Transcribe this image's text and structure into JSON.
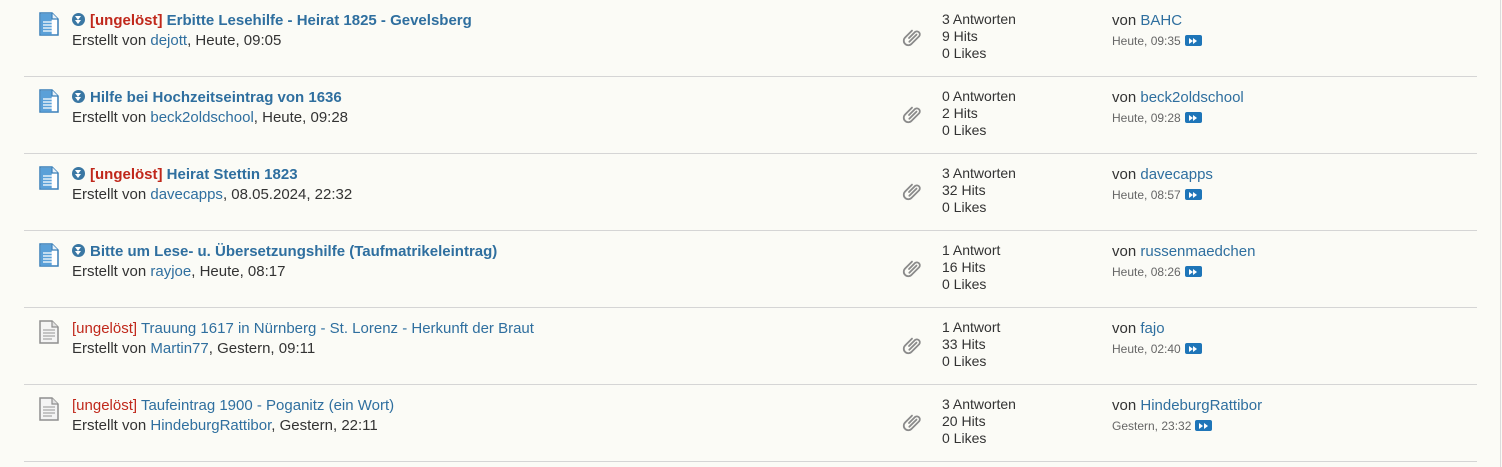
{
  "labels": {
    "created_by": "Erstellt von",
    "by": "von"
  },
  "colors": {
    "link": "#2f6f9f",
    "prefix_red": "#c0281b",
    "badge_blue": "#3a77a3",
    "jump_blue": "#1e75b8",
    "background": "#fbfbf6"
  },
  "threads": [
    {
      "unread": true,
      "icon": "unread-thread-icon",
      "prefix": "[ungelöst]",
      "title": "Erbitte Lesehilfe - Heirat 1825 - Gevelsberg",
      "author": "dejott",
      "created": ", Heute, 09:05",
      "replies": "3 Antworten",
      "hits": "9 Hits",
      "likes": "0 Likes",
      "last_user": "BAHC",
      "last_time": "Heute, 09:35"
    },
    {
      "unread": true,
      "icon": "unread-thread-icon",
      "prefix": "",
      "title": "Hilfe bei Hochzeitseintrag von 1636",
      "author": "beck2oldschool",
      "created": ", Heute, 09:28",
      "replies": "0 Antworten",
      "hits": "2 Hits",
      "likes": "0 Likes",
      "last_user": "beck2oldschool",
      "last_time": "Heute, 09:28"
    },
    {
      "unread": true,
      "icon": "unread-thread-icon",
      "prefix": "[ungelöst]",
      "title": "Heirat Stettin 1823",
      "author": "davecapps",
      "created": ", 08.05.2024, 22:32",
      "replies": "3 Antworten",
      "hits": "32 Hits",
      "likes": "0 Likes",
      "last_user": "davecapps",
      "last_time": "Heute, 08:57"
    },
    {
      "unread": true,
      "icon": "unread-thread-icon",
      "prefix": "",
      "title": "Bitte um Lese- u. Übersetzungshilfe (Taufmatrikeleintrag)",
      "author": "rayjoe",
      "created": ", Heute, 08:17",
      "replies": "1 Antwort",
      "hits": "16 Hits",
      "likes": "0 Likes",
      "last_user": "russenmaedchen",
      "last_time": "Heute, 08:26"
    },
    {
      "unread": false,
      "icon": "read-thread-icon",
      "prefix": "[ungelöst]",
      "title": "Trauung 1617 in Nürnberg - St. Lorenz - Herkunft der Braut",
      "author": "Martin77",
      "created": ", Gestern, 09:11",
      "replies": "1 Antwort",
      "hits": "33 Hits",
      "likes": "0 Likes",
      "last_user": "fajo",
      "last_time": "Heute, 02:40"
    },
    {
      "unread": false,
      "icon": "read-thread-icon",
      "prefix": "[ungelöst]",
      "title": "Taufeintrag 1900 - Poganitz (ein Wort)",
      "author": "HindeburgRattibor",
      "created": ", Gestern, 22:11",
      "replies": "3 Antworten",
      "hits": "20 Hits",
      "likes": "0 Likes",
      "last_user": "HindeburgRattibor",
      "last_time": "Gestern, 23:32"
    }
  ]
}
